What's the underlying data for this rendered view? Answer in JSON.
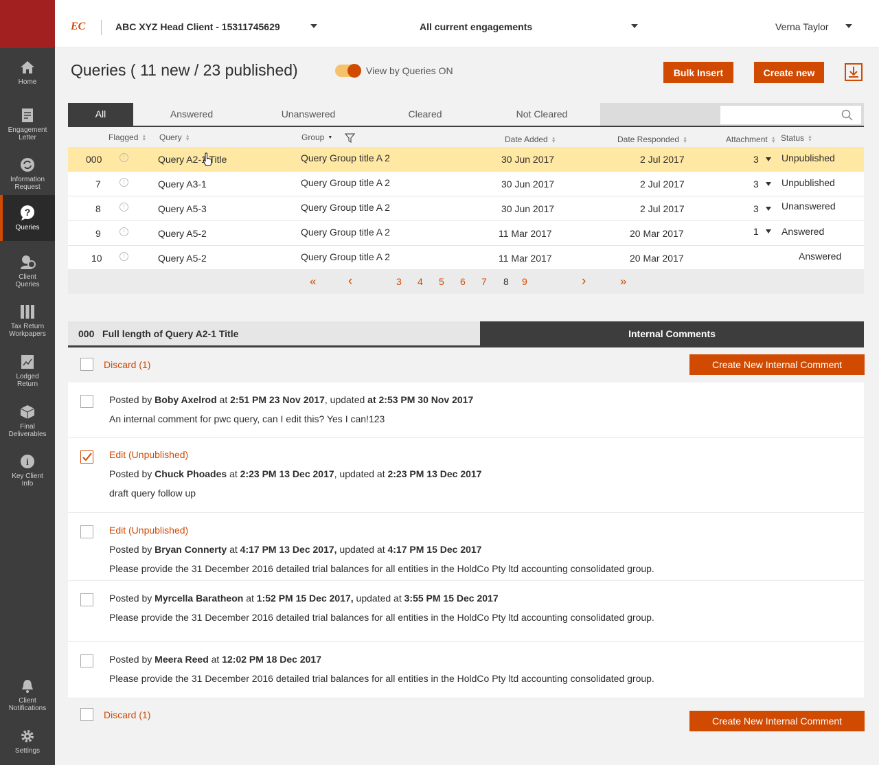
{
  "app": {
    "logo_text": "EC",
    "client_name": "ABC XYZ Head Client - 15311745629",
    "engagements": "All current engagements",
    "user_name": "Verna Taylor"
  },
  "sidebar": {
    "items": [
      {
        "label_1": "Home",
        "label_2": "",
        "label_3": "",
        "icon": "home-icon"
      },
      {
        "label_1": "Engagement",
        "label_2": "Letter",
        "label_3": "",
        "icon": "letter-icon"
      },
      {
        "label_1": "Information",
        "label_2": "Request",
        "label_3": "",
        "icon": "refresh-icon"
      },
      {
        "label_1": "Queries",
        "label_2": "",
        "label_3": "",
        "icon": "question-icon"
      },
      {
        "label_1": "Client",
        "label_2": "Queries",
        "label_3": "",
        "icon": "client-query-icon"
      },
      {
        "label_1": "Tax Return",
        "label_2": "Workpapers",
        "label_3": "",
        "icon": "binders-icon"
      },
      {
        "label_1": "Lodged",
        "label_2": "Return",
        "label_3": "",
        "icon": "lodged-icon"
      },
      {
        "label_1": "Final",
        "label_2": "Deliverables",
        "label_3": "",
        "icon": "box-icon"
      },
      {
        "label_1": "Key Client",
        "label_2": "Info",
        "label_3": "",
        "icon": "info-icon"
      },
      {
        "label_1": "Client",
        "label_2": "Notifications",
        "label_3": "",
        "icon": "bell-icon"
      },
      {
        "label_1": "Settings",
        "label_2": "",
        "label_3": "",
        "icon": "gear-icon"
      }
    ]
  },
  "header": {
    "title": "Queries ( 11 new / 23 published)",
    "toggle_label": "View by Queries ON",
    "bulk_insert": "Bulk Insert",
    "create_new": "Create new"
  },
  "tabs": [
    "All",
    "Answered",
    "Unanswered",
    "Cleared",
    "Not Cleared"
  ],
  "search": {
    "placeholder": ""
  },
  "table": {
    "columns": [
      "Flagged",
      "Query",
      "Group",
      "Date Added",
      "Date Responded",
      "Attachment",
      "Status"
    ],
    "rows": [
      {
        "id": "000",
        "query": "Query A2-1 Title",
        "group": "Query Group title A 2",
        "date_added": "30 Jun 2017",
        "date_responded": "2 Jul 2017",
        "attachment": "3",
        "status": "Unpublished"
      },
      {
        "id": "7",
        "query": "Query A3-1",
        "group": "Query Group title A 2",
        "date_added": "30 Jun 2017",
        "date_responded": "2 Jul 2017",
        "attachment": "3",
        "status": "Unpublished"
      },
      {
        "id": "8",
        "query": "Query A5-3",
        "group": "Query Group title A 2",
        "date_added": "30 Jun 2017",
        "date_responded": "2 Jul 2017",
        "attachment": "3",
        "status": "Unanswered"
      },
      {
        "id": "9",
        "query": "Query A5-2",
        "group": "Query Group title A 2",
        "date_added": "11 Mar 2017",
        "date_responded": "20 Mar 2017",
        "attachment": "1",
        "status": "Answered"
      },
      {
        "id": "10",
        "query": "Query A5-2",
        "group": "Query Group title A 2",
        "date_added": "11 Mar 2017",
        "date_responded": "20 Mar 2017",
        "attachment": "",
        "status": "Answered"
      }
    ]
  },
  "pager": {
    "first": "«",
    "prev": "‹",
    "pages": [
      "3",
      "4",
      "5",
      "6",
      "7",
      "8",
      "9"
    ],
    "current": "8",
    "next": "›",
    "last": "»"
  },
  "detail": {
    "id": "000",
    "title": "Full length of Query A2-1 Title",
    "tab_label": "Internal Comments",
    "discard_label": "Discard (1)",
    "create_label": "Create New  Internal Comment",
    "comments": [
      {
        "edit": "",
        "posted_by_prefix": "Posted by ",
        "author": "Boby Axelrod",
        "at": " at ",
        "posted_time": "2:51 PM 23 Nov 2017",
        "updated_prefix": ", updated ",
        "updated_bold": "at 2:53 PM 30 Nov 2017",
        "text": "An internal comment for pwc query, can I edit this? Yes I can!123",
        "checked": false
      },
      {
        "edit": "Edit (Unpublished)",
        "posted_by_prefix": "Posted by ",
        "author": "Chuck Phoades",
        "at": " at ",
        "posted_time": "2:23 PM 13 Dec 2017",
        "updated_prefix": ", updated at ",
        "updated_bold": "2:23 PM 13 Dec 2017",
        "text": "draft query follow up",
        "checked": true
      },
      {
        "edit": "Edit (Unpublished)",
        "posted_by_prefix": "Posted by ",
        "author": "Bryan Connerty",
        "at": " at ",
        "posted_time": "4:17 PM 13 Dec 2017,",
        "updated_prefix": " updated at ",
        "updated_bold": "4:17 PM 15 Dec 2017",
        "text": "Please provide the 31 December 2016 detailed trial balances for all entities in the HoldCo Pty ltd accounting consolidated group.",
        "checked": false
      },
      {
        "edit": "",
        "posted_by_prefix": "Posted by ",
        "author": "Myrcella Baratheon",
        "at": " at ",
        "posted_time": "1:52 PM 15 Dec 2017,",
        "updated_prefix": " updated at ",
        "updated_bold": "3:55 PM 15 Dec 2017",
        "text": "Please provide the 31 December 2016 detailed trial balances for all entities in the HoldCo Pty ltd accounting consolidated group.",
        "checked": false
      },
      {
        "edit": "",
        "posted_by_prefix": "Posted by ",
        "author": "Meera Reed",
        "at": " at ",
        "posted_time": "12:02 PM 18 Dec 2017",
        "updated_prefix": "",
        "updated_bold": "",
        "text": "Please provide the 31 December 2016 detailed trial balances for all entities in the HoldCo Pty ltd accounting consolidated group.",
        "checked": false
      }
    ]
  },
  "colors": {
    "accent": "#d04a02",
    "sidebar": "#3d3d3d",
    "brand": "#a32020",
    "selected_row": "#ffe8a3"
  }
}
